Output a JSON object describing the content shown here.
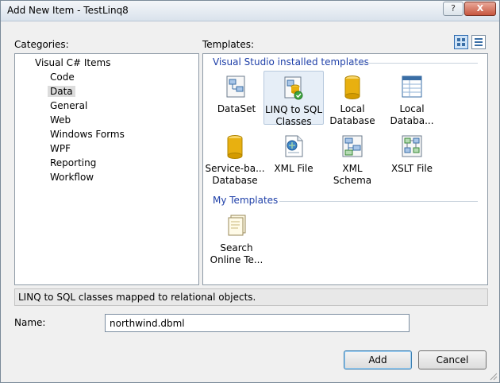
{
  "window": {
    "title": "Add New Item - TestLinq8",
    "help_label": "?",
    "close_label": "X"
  },
  "categories": {
    "label": "Categories:",
    "items": [
      {
        "label": "Visual C# Items",
        "level": 0,
        "selected": false
      },
      {
        "label": "Code",
        "level": 1,
        "selected": false
      },
      {
        "label": "Data",
        "level": 1,
        "selected": true
      },
      {
        "label": "General",
        "level": 1,
        "selected": false
      },
      {
        "label": "Web",
        "level": 1,
        "selected": false
      },
      {
        "label": "Windows Forms",
        "level": 1,
        "selected": false
      },
      {
        "label": "WPF",
        "level": 1,
        "selected": false
      },
      {
        "label": "Reporting",
        "level": 1,
        "selected": false
      },
      {
        "label": "Workflow",
        "level": 1,
        "selected": false
      }
    ]
  },
  "templates": {
    "label": "Templates:",
    "view_buttons": [
      {
        "icon": "large-icons-view-icon",
        "active": true
      },
      {
        "icon": "small-icons-view-icon",
        "active": false
      }
    ],
    "installed_group": "Visual Studio installed templates",
    "installed": [
      {
        "line1": "DataSet",
        "line2": "",
        "icon": "dataset-icon",
        "selected": false
      },
      {
        "line1": "LINQ to SQL",
        "line2": "Classes",
        "icon": "linq-to-sql-icon",
        "selected": true
      },
      {
        "line1": "Local",
        "line2": "Database",
        "icon": "local-database-icon",
        "selected": false
      },
      {
        "line1": "Local",
        "line2": "Databa...",
        "icon": "local-database-cache-icon",
        "selected": false
      },
      {
        "line1": "Service-ba...",
        "line2": "Database",
        "icon": "service-database-icon",
        "selected": false
      },
      {
        "line1": "XML File",
        "line2": "",
        "icon": "xml-file-icon",
        "selected": false
      },
      {
        "line1": "XML Schema",
        "line2": "",
        "icon": "xml-schema-icon",
        "selected": false
      },
      {
        "line1": "XSLT File",
        "line2": "",
        "icon": "xslt-file-icon",
        "selected": false
      }
    ],
    "my_group": "My Templates",
    "mine": [
      {
        "line1": "Search",
        "line2": "Online Te...",
        "icon": "search-online-templates-icon",
        "selected": false
      }
    ]
  },
  "description": "LINQ to SQL classes mapped to relational objects.",
  "name_field": {
    "label": "Name:",
    "value": "northwind.dbml"
  },
  "buttons": {
    "add": "Add",
    "cancel": "Cancel"
  },
  "colors": {
    "group_heading": "#1e3fa8",
    "selection_bg": "#e6eef7",
    "db_gold": "#e8b010"
  }
}
